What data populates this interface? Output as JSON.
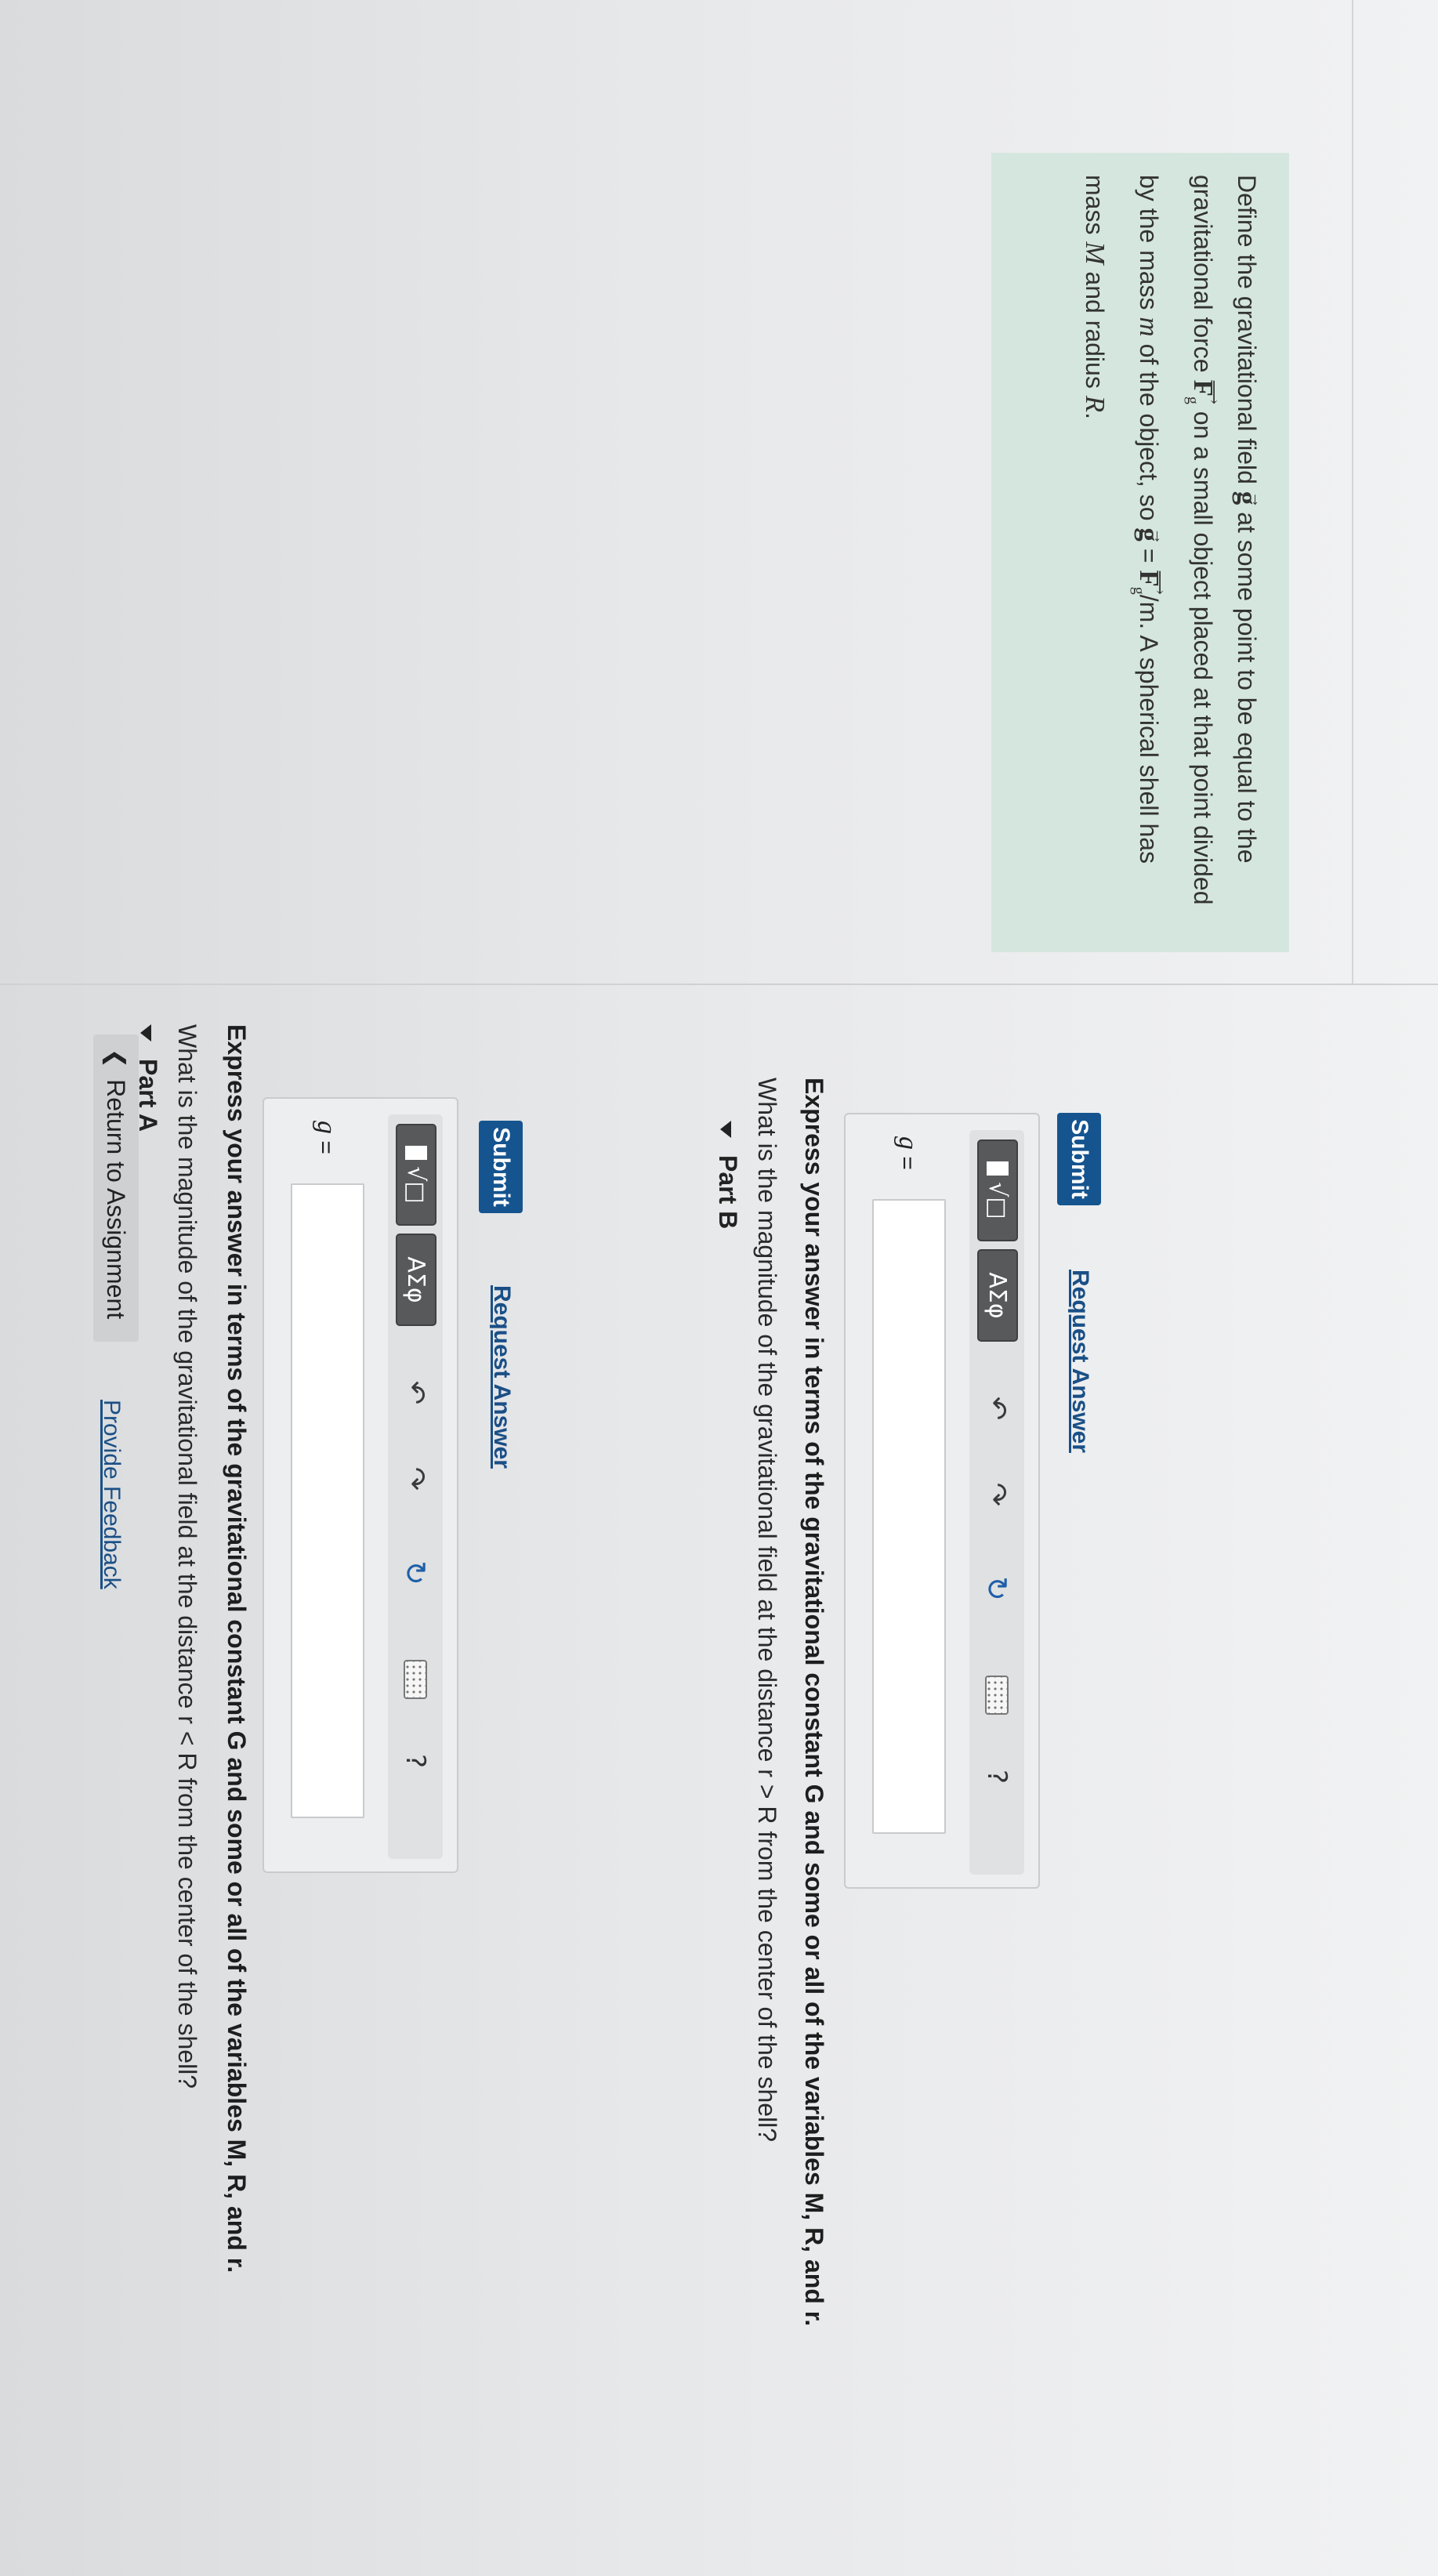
{
  "intro": {
    "text_1": "Define the gravitational field",
    "text_2": "at some point to be equal to the",
    "text_3": "gravitational force",
    "text_4": "on a small object placed at that point divided",
    "text_5": "by the mass",
    "text_6": "of the object, so",
    "text_7": "/m. A spherical shell has",
    "text_8": "mass",
    "text_9": "and radius",
    "var_g": "g",
    "var_F": "F",
    "sub_g": "g",
    "var_m": "m",
    "var_M": "M",
    "var_R": "R",
    "equals": "="
  },
  "part_a": {
    "title": "Part A",
    "question": "What is the magnitude of the gravitational field at the distance r < R from the center of the shell?",
    "instruction": "Express your answer in terms of the gravitational constant G and some or all of the variables M, R, and r.",
    "eq_var": "g",
    "eq_sign": "=",
    "submit_label": "Submit",
    "request_label": "Request Answer"
  },
  "part_b": {
    "title": "Part B",
    "question": "What is the magnitude of the gravitational field at the distance r > R from the center of the shell?",
    "instruction": "Express your answer in terms of the gravitational constant G and some or all of the variables M, R, and r.",
    "eq_var": "g",
    "eq_sign": "=",
    "submit_label": "Submit",
    "request_label": "Request Answer"
  },
  "toolbar": {
    "greek_label": "ΑΣφ",
    "template_label": "√□",
    "help_label": "?",
    "icons": [
      "templates-icon",
      "greek-icon",
      "undo-icon",
      "redo-icon",
      "reset-icon",
      "keyboard-icon",
      "help-icon"
    ]
  },
  "footer": {
    "return_label": "Return to Assignment",
    "feedback_label": "Provide Feedback"
  },
  "colors": {
    "intro_bg": "#d5e6de",
    "submit_bg": "#15548f",
    "link": "#1a4f86"
  }
}
